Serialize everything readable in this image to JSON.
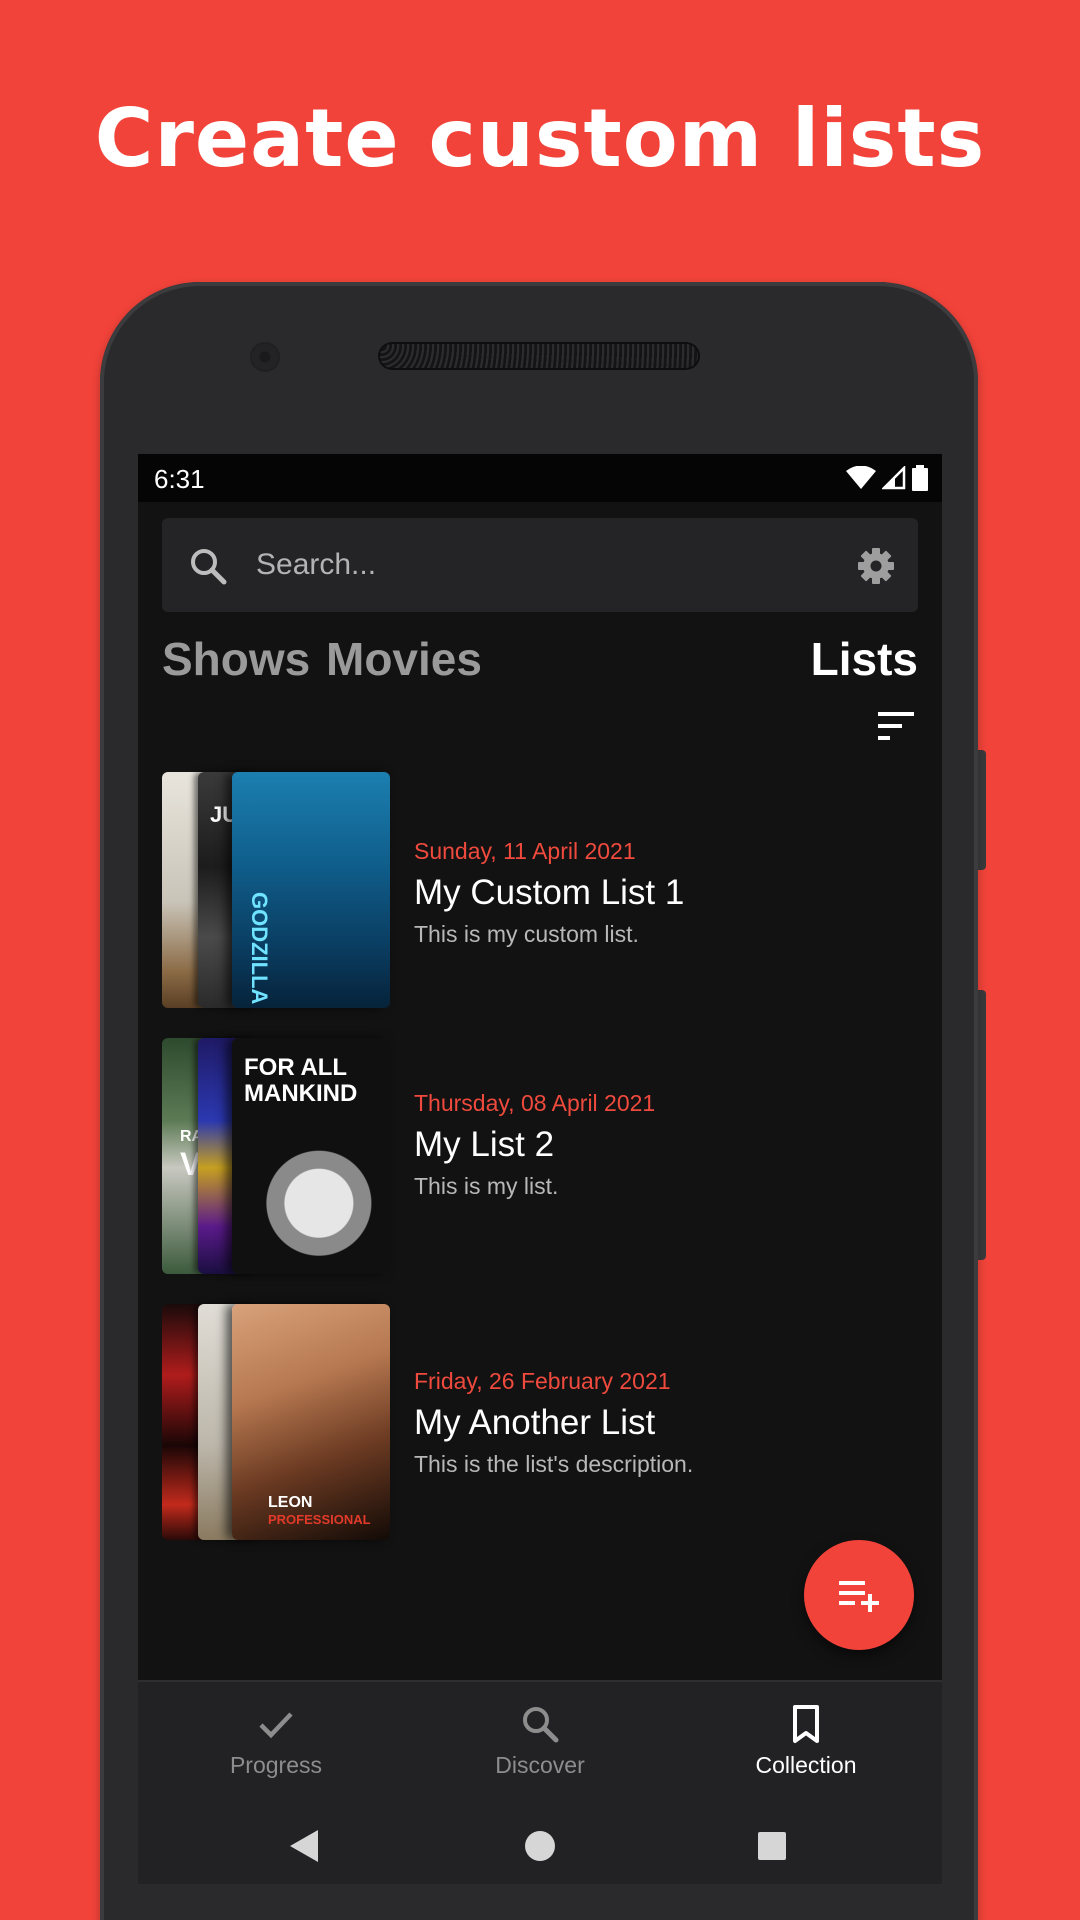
{
  "headline": "Create custom lists",
  "status_bar": {
    "time": "6:31"
  },
  "search": {
    "placeholder": "Search..."
  },
  "tabs": {
    "shows": "Shows",
    "movies": "Movies",
    "lists": "Lists",
    "active": "Lists"
  },
  "lists": [
    {
      "date": "Sunday, 11 April 2021",
      "title": "My Custom List 1",
      "description": "This is my custom list.",
      "poster_texts": [
        "JUS",
        "GODZILLA"
      ]
    },
    {
      "date": "Thursday, 08 April 2021",
      "title": "My List 2",
      "description": "This is my list.",
      "poster_texts": [
        "RA",
        "V",
        "FOR ALL",
        "MANKIND"
      ]
    },
    {
      "date": "Friday, 26 February 2021",
      "title": "My Another List",
      "description": "This is the list's description.",
      "poster_texts": [
        "LEON",
        "PROFESSIONAL"
      ]
    }
  ],
  "bottom_nav": [
    {
      "label": "Progress",
      "icon": "check-icon",
      "active": false
    },
    {
      "label": "Discover",
      "icon": "search-icon",
      "active": false
    },
    {
      "label": "Collection",
      "icon": "bookmark-icon",
      "active": true
    }
  ],
  "colors": {
    "brand": "#f2433a",
    "accent_date": "#ef4a3d",
    "screen_bg": "#121212"
  }
}
